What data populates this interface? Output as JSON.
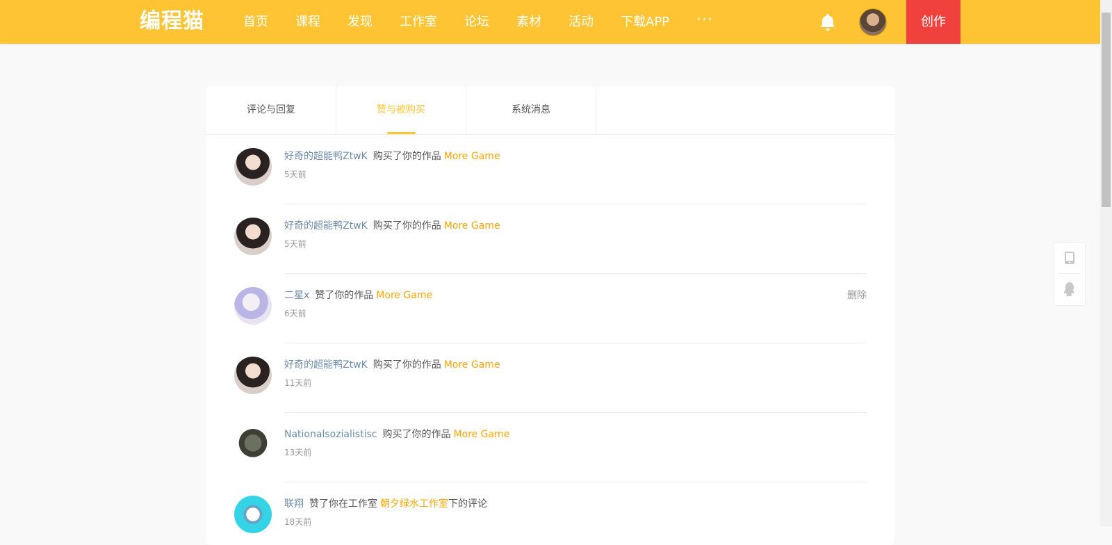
{
  "header": {
    "logo": "编程猫",
    "nav": [
      "首页",
      "课程",
      "发现",
      "工作室",
      "论坛",
      "素材",
      "活动",
      "下载APP"
    ],
    "more": "···",
    "create_label": "创作",
    "colors": {
      "brand": "#fec433",
      "create": "#f0413d"
    }
  },
  "tabs": [
    {
      "label": "评论与回复"
    },
    {
      "label": "赞与被购买",
      "active": true
    },
    {
      "label": "系统消息"
    }
  ],
  "messages": [
    {
      "user": "好奇的超能鸭ZtwK",
      "action": "购买了你的作品",
      "target": "More Game",
      "time": "5天前"
    },
    {
      "user": "好奇的超能鸭ZtwK",
      "action": "购买了你的作品",
      "target": "More Game",
      "time": "5天前"
    },
    {
      "user": "二星x",
      "action": "赞了你的作品",
      "target": "More Game",
      "time": "6天前",
      "delete": "删除"
    },
    {
      "user": "好奇的超能鸭ZtwK",
      "action": "购买了你的作品",
      "target": "More Game",
      "time": "11天前"
    },
    {
      "user": "Nationalsozialistisc",
      "action": "购买了你的作品",
      "target": "More Game",
      "time": "13天前"
    },
    {
      "user": "联翔",
      "action": "赞了你在工作室",
      "target": "朝夕绿水工作室",
      "suffix": "下的评论",
      "time": "18天前"
    }
  ],
  "icons": {
    "bell": "bell-icon",
    "tablet": "tablet-icon",
    "qq": "qq-icon"
  }
}
